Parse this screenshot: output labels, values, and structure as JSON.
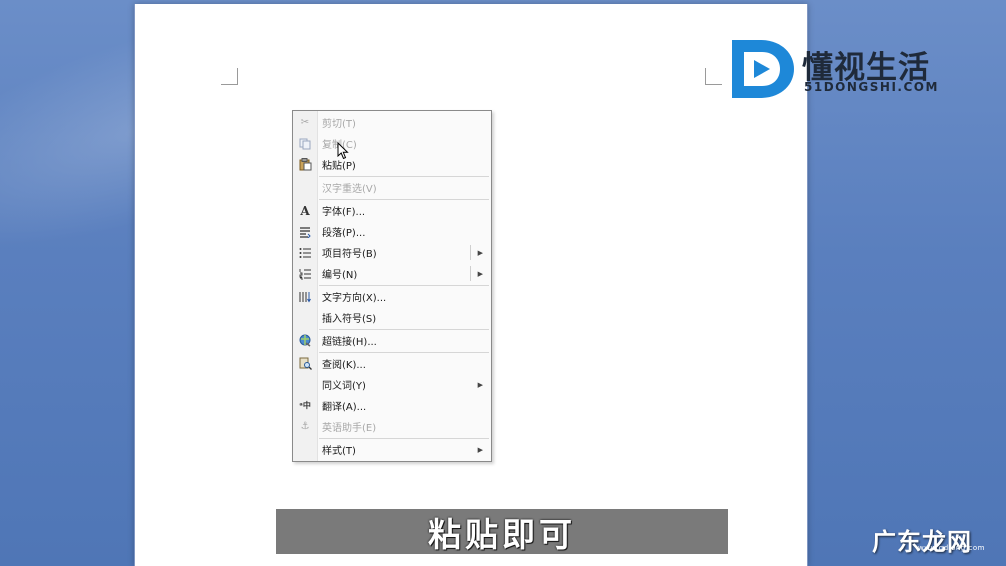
{
  "context_menu": {
    "items": [
      {
        "label": "剪切(T)",
        "icon": "scissors-icon",
        "disabled": true,
        "submenu": false
      },
      {
        "label": "复制(C)",
        "icon": "copy-icon",
        "disabled": true,
        "submenu": false
      },
      {
        "label": "粘贴(P)",
        "icon": "paste-icon",
        "disabled": false,
        "submenu": false
      },
      {
        "label": "汉字重选(V)",
        "icon": "",
        "disabled": true,
        "submenu": false
      },
      {
        "label": "字体(F)...",
        "icon": "font-icon",
        "disabled": false,
        "submenu": false
      },
      {
        "label": "段落(P)...",
        "icon": "paragraph-icon",
        "disabled": false,
        "submenu": false
      },
      {
        "label": "项目符号(B)",
        "icon": "bullets-icon",
        "disabled": false,
        "submenu": true
      },
      {
        "label": "编号(N)",
        "icon": "numbering-icon",
        "disabled": false,
        "submenu": true
      },
      {
        "label": "文字方向(X)...",
        "icon": "text-direction-icon",
        "disabled": false,
        "submenu": false
      },
      {
        "label": "插入符号(S)",
        "icon": "",
        "disabled": false,
        "submenu": false
      },
      {
        "label": "超链接(H)...",
        "icon": "hyperlink-icon",
        "disabled": false,
        "submenu": false
      },
      {
        "label": "查阅(K)...",
        "icon": "lookup-icon",
        "disabled": false,
        "submenu": false
      },
      {
        "label": "同义词(Y)",
        "icon": "",
        "disabled": false,
        "submenu": true
      },
      {
        "label": "翻译(A)...",
        "icon": "translate-icon",
        "disabled": false,
        "submenu": false
      },
      {
        "label": "英语助手(E)",
        "icon": "assistant-icon",
        "disabled": true,
        "submenu": false
      },
      {
        "label": "样式(T)",
        "icon": "",
        "disabled": false,
        "submenu": true
      }
    ]
  },
  "logo": {
    "title": "懂视生活",
    "subtitle": "51DONGSHI.COM",
    "color": "#1e88d8"
  },
  "caption": {
    "text": "粘贴即可"
  },
  "watermark": {
    "text": "广东龙网",
    "subtitle": "www.gdlong.com"
  },
  "colors": {
    "background": "#5a7fbe",
    "page": "#ffffff",
    "caption_bg": "#7a7a7a"
  }
}
